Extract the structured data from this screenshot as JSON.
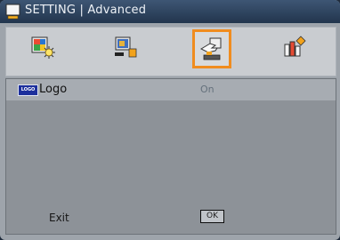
{
  "window": {
    "title": "SETTING | Advanced",
    "title_icon": "projector-screen-icon"
  },
  "tabs": [
    {
      "name": "image-tab",
      "icon": "picture-settings-icon",
      "active": false
    },
    {
      "name": "display-tab",
      "icon": "display-settings-icon",
      "active": false
    },
    {
      "name": "setting-tab",
      "icon": "setup-hand-icon",
      "active": true
    },
    {
      "name": "options-tab",
      "icon": "options-bars-icon",
      "active": false
    }
  ],
  "items": [
    {
      "icon": "logo-icon",
      "icon_text": "LOGO",
      "label": "Logo",
      "value": "On"
    }
  ],
  "footer": {
    "exit_label": "Exit",
    "ok_label": "OK"
  },
  "colors": {
    "active_tab_border": "#f08c1e",
    "title_bar": "#2f4562"
  }
}
